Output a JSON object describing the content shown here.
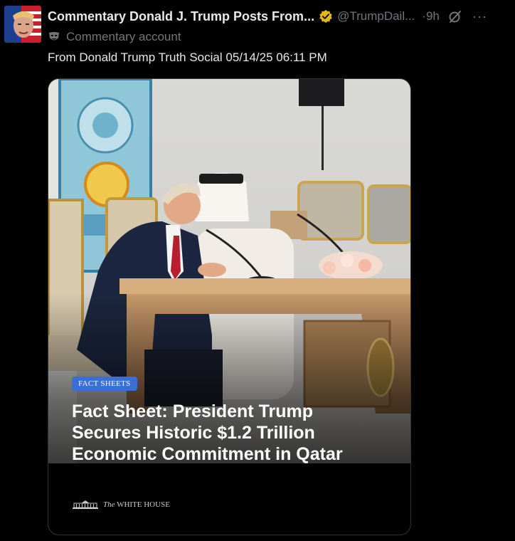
{
  "post": {
    "display_name": "Commentary Donald J. Trump Posts From...",
    "handle": "@TrumpDail...",
    "separator": "·",
    "time": "9h",
    "more": "···",
    "commentary_label": "Commentary account",
    "text": "From Donald Trump Truth Social 05/14/25 06:11 PM"
  },
  "card": {
    "tag": "FACT SHEETS",
    "headline": "Fact Sheet: President Trump Secures Historic $1.2 Trillion Economic Commitment in Qatar",
    "logo_article": "The",
    "logo_name": "WHITE HOUSE"
  },
  "colors": {
    "background": "#000000",
    "text_primary": "#e7e9ea",
    "text_secondary": "#71767b",
    "verified": "#e2b719",
    "tag": "#3b6fd6"
  }
}
